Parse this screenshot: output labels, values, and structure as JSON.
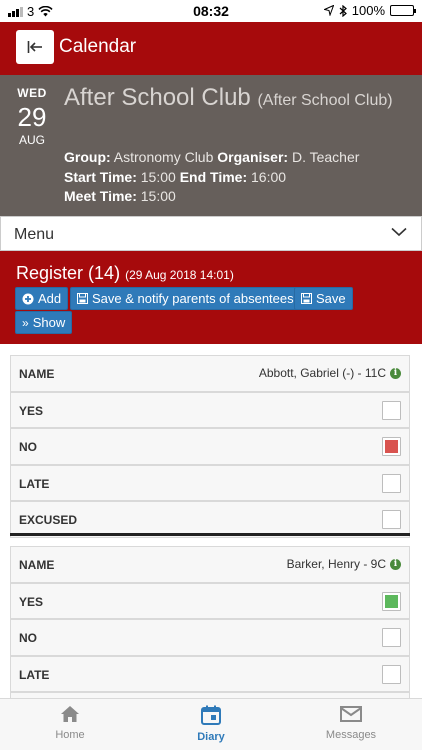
{
  "status_bar": {
    "carrier": "3",
    "time": "08:32",
    "battery": "100%"
  },
  "header": {
    "title": "Calendar"
  },
  "event": {
    "dow": "WED",
    "day": "29",
    "month": "AUG",
    "title": "After School Club",
    "subtitle": "(After School Club)",
    "group_label": "Group:",
    "group_value": "Astronomy Club",
    "organiser_label": "Organiser:",
    "organiser_value": "D. Teacher",
    "start_label": "Start Time:",
    "start_value": "15:00",
    "end_label": "End Time:",
    "end_value": "16:00",
    "meet_label": "Meet Time:",
    "meet_value": "15:00"
  },
  "menu": {
    "label": "Menu"
  },
  "register": {
    "title": "Register",
    "count": "(14)",
    "timestamp": "(29 Aug 2018 14:01)",
    "buttons": {
      "add": "Add",
      "save_notify": "Save & notify parents of absentees",
      "save": "Save",
      "show": "Show"
    }
  },
  "students": [
    {
      "name_label": "NAME",
      "name": "Abbott, Gabriel (-) - 11C",
      "options": [
        {
          "label": "YES",
          "state": "empty"
        },
        {
          "label": "NO",
          "state": "red"
        },
        {
          "label": "LATE",
          "state": "empty"
        },
        {
          "label": "EXCUSED",
          "state": "empty"
        }
      ]
    },
    {
      "name_label": "NAME",
      "name": "Barker, Henry - 9C",
      "options": [
        {
          "label": "YES",
          "state": "green"
        },
        {
          "label": "NO",
          "state": "empty"
        },
        {
          "label": "LATE",
          "state": "empty"
        }
      ]
    }
  ],
  "colors": {
    "red_mark": "#d9534f",
    "green_mark": "#5cb85c",
    "brand": "#a60a0c",
    "button": "#2f7ab9"
  },
  "tabbar": {
    "tabs": [
      {
        "label": "Home",
        "icon": "home-icon"
      },
      {
        "label": "Diary",
        "icon": "calendar-icon"
      },
      {
        "label": "Messages",
        "icon": "mail-icon"
      }
    ]
  }
}
